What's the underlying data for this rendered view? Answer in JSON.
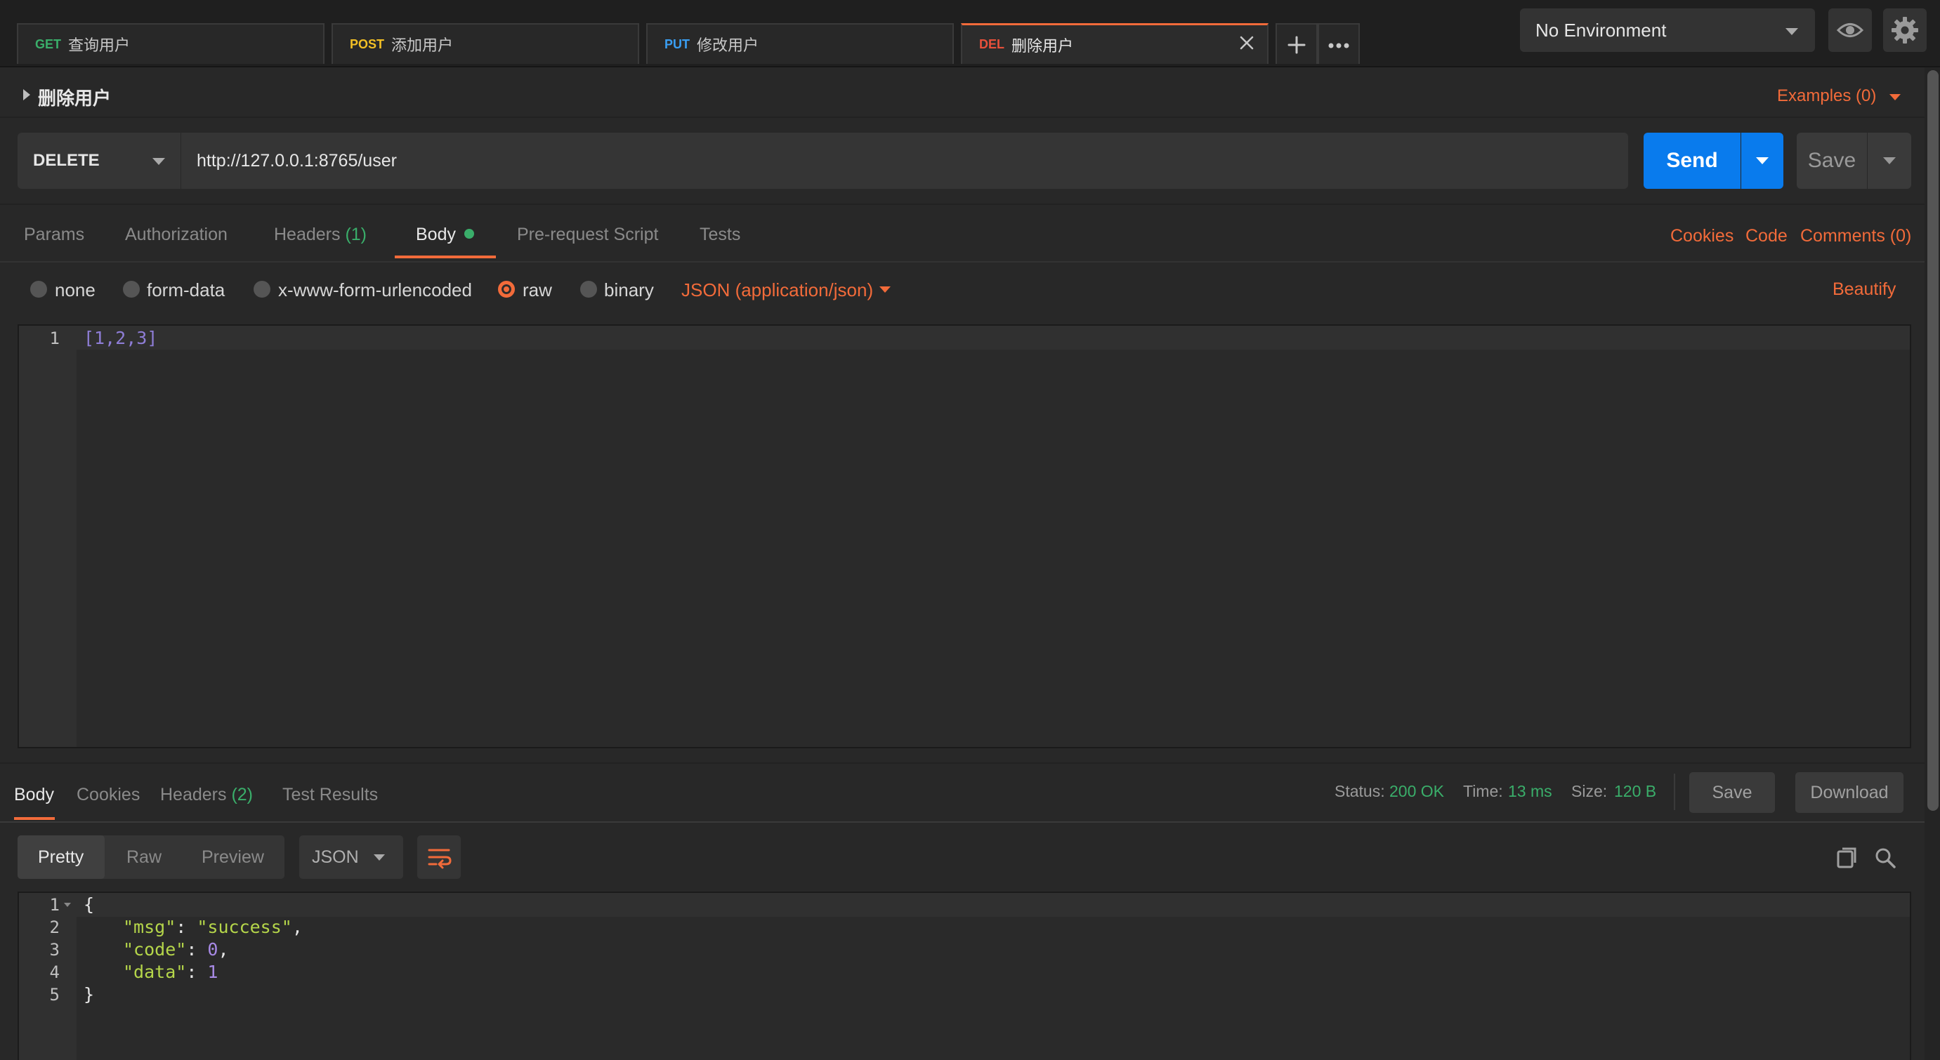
{
  "tabs": [
    {
      "method": "GET",
      "name": "查询用户",
      "color": "#3aae6a"
    },
    {
      "method": "POST",
      "name": "添加用户",
      "color": "#f3c025"
    },
    {
      "method": "PUT",
      "name": "修改用户",
      "color": "#3a9ef2"
    },
    {
      "method": "DEL",
      "name": "删除用户",
      "color": "#e8503a",
      "active": true
    }
  ],
  "environment": {
    "selected": "No Environment"
  },
  "request": {
    "name": "删除用户",
    "examples": "Examples (0)",
    "method": "DELETE",
    "url": "http://127.0.0.1:8765/user",
    "send_label": "Send",
    "save_label": "Save"
  },
  "request_tabs": {
    "params": "Params",
    "authorization": "Authorization",
    "headers": "Headers",
    "headers_count": "(1)",
    "body": "Body",
    "prerequest": "Pre-request Script",
    "tests": "Tests",
    "cookies": "Cookies",
    "code": "Code",
    "comments": "Comments (0)"
  },
  "body_types": {
    "none": "none",
    "form_data": "form-data",
    "urlencoded": "x-www-form-urlencoded",
    "raw": "raw",
    "binary": "binary",
    "selected": "raw",
    "content_type": "JSON (application/json)",
    "beautify": "Beautify"
  },
  "request_body": {
    "lines": [
      "1"
    ],
    "code": "[1,2,3]"
  },
  "response": {
    "tabs": {
      "body": "Body",
      "cookies": "Cookies",
      "headers": "Headers",
      "headers_count": "(2)",
      "test_results": "Test Results"
    },
    "status_label": "Status:",
    "status_value": "200 OK",
    "time_label": "Time:",
    "time_value": "13 ms",
    "size_label": "Size:",
    "size_value": "120 B",
    "save_label": "Save",
    "download_label": "Download",
    "formats": {
      "pretty": "Pretty",
      "raw": "Raw",
      "preview": "Preview",
      "type": "JSON"
    },
    "lines": [
      "1",
      "2",
      "3",
      "4",
      "5"
    ],
    "code": {
      "l1": "{",
      "msg_key": "\"msg\"",
      "msg_val": "\"success\"",
      "code_key": "\"code\"",
      "code_val": "0",
      "data_key": "\"data\"",
      "data_val": "1",
      "l5": "}"
    }
  },
  "colors": {
    "accent": "#f26b3a",
    "send": "#097bed",
    "success": "#3aae6a"
  }
}
